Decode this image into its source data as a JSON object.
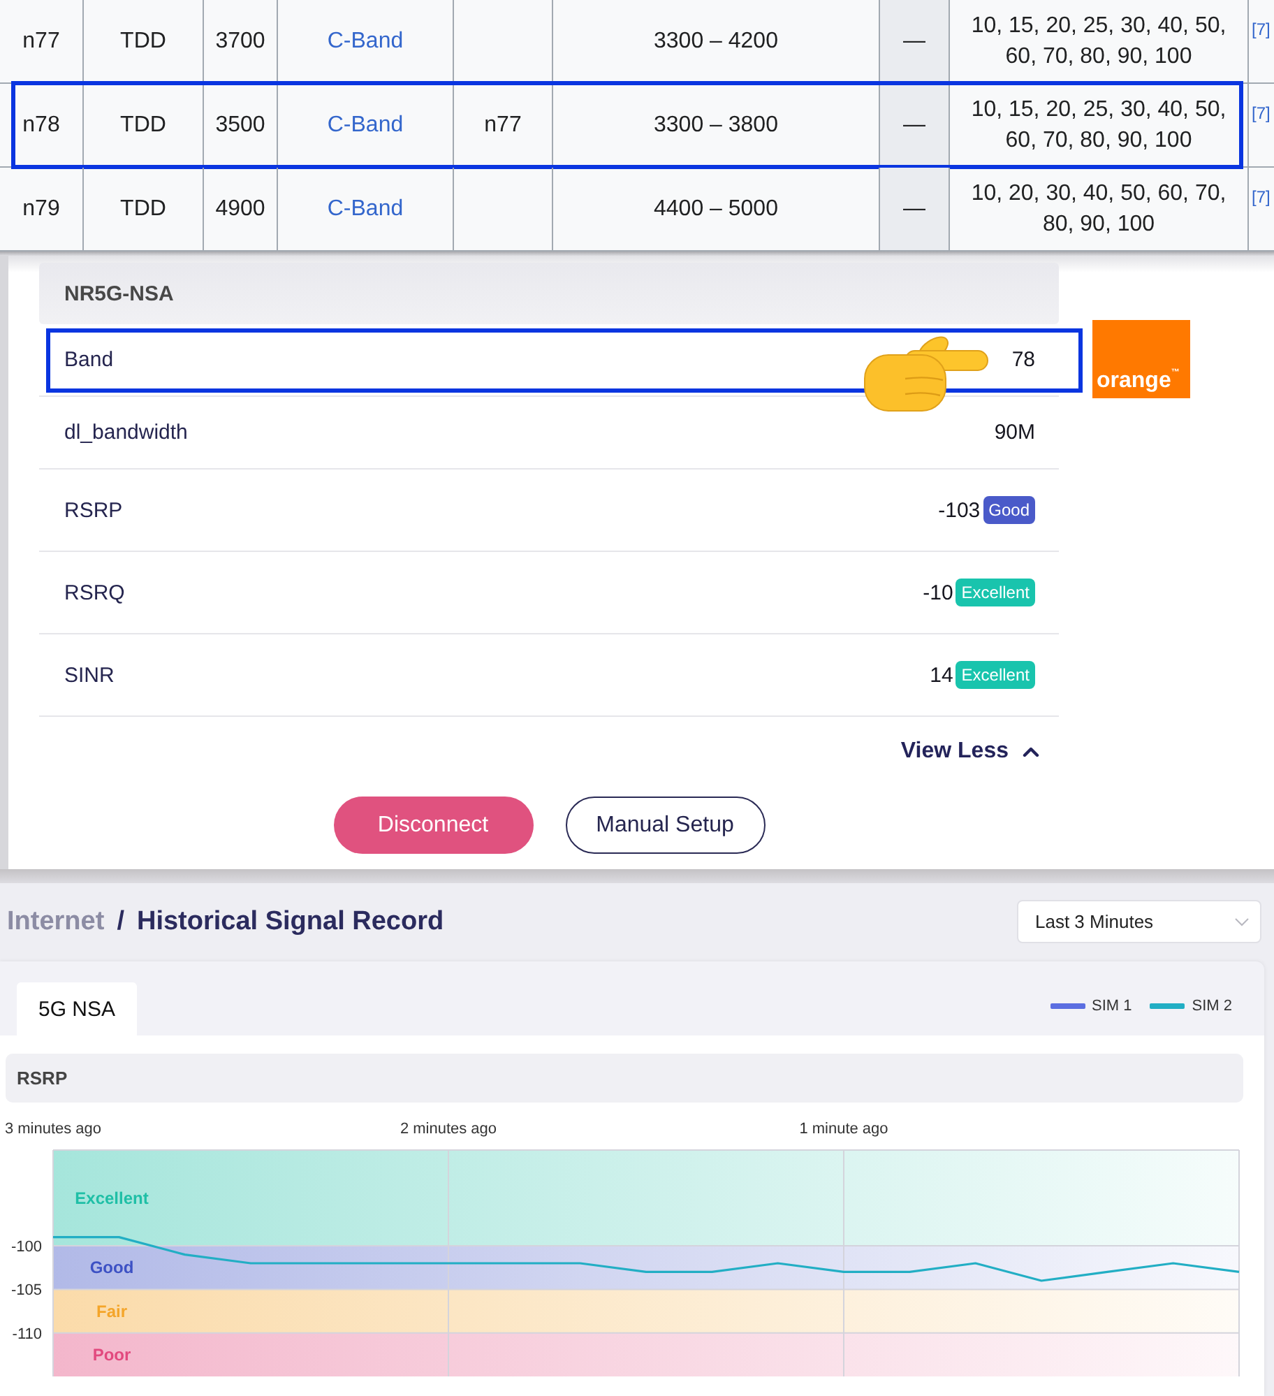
{
  "band_table": {
    "rows": [
      {
        "column_1": "n77",
        "column_2": "TDD",
        "column_3": "3700",
        "column_4": "C-Band",
        "column_6": "3300 – 4200",
        "column_7": "—",
        "column_8": "10, 15, 20, 25, 30, 40, 50, 60, 70, 80, 90, 100",
        "column_9": "[7]",
        "highlighted": false
      },
      {
        "column_1": "n78",
        "column_2": "TDD",
        "column_3": "3500",
        "column_4": "C-Band",
        "column_5": "n77",
        "column_6": "3300 – 3800",
        "column_7": "—",
        "column_8": "10, 15, 20, 25, 30, 40, 50, 60, 70, 80, 90, 100",
        "column_9": "[7]",
        "highlighted": true
      },
      {
        "column_1": "n79",
        "column_2": "TDD",
        "column_3": "4900",
        "column_4": "C-Band",
        "column_6": "4400 – 5000",
        "column_7": "—",
        "column_8": "10, 20, 30, 40, 50, 60, 70, 80, 90, 100",
        "column_9": "[7]",
        "highlighted": false
      }
    ]
  },
  "signal_panel": {
    "title": "NR5G-NSA",
    "rows": [
      {
        "label": "Band",
        "value": "78",
        "highlighted": true
      },
      {
        "label": "dl_bandwidth",
        "value": "90M",
        "highlighted": false
      },
      {
        "label": "RSRP",
        "value": "-103",
        "badge": {
          "text": "Good",
          "color": "#4a5ac9"
        },
        "highlighted": false
      },
      {
        "label": "RSRQ",
        "value": "-10",
        "badge": {
          "text": "Excellent",
          "color": "#19c4ad"
        },
        "highlighted": false
      },
      {
        "label": "SINR",
        "value": "14",
        "badge": {
          "text": "Excellent",
          "color": "#19c4ad"
        },
        "highlighted": false
      }
    ],
    "toggle": {
      "label": "View Less",
      "expanded": true
    },
    "buttons": [
      {
        "label": "Disconnect",
        "kind": "primary"
      },
      {
        "label": "Manual Setup",
        "kind": "outline"
      }
    ]
  },
  "logo": {
    "text": "orange$^{™}$"
  },
  "history": {
    "breadcrumb": [
      {
        "label": "Internet",
        "current": false
      },
      {
        "label": "Historical Signal Record",
        "current": true
      }
    ],
    "separator": "/",
    "range_select": {
      "value": "Last 3 Minutes"
    },
    "tabs": [
      {
        "label": "5G NSA",
        "selected": true
      }
    ],
    "zones": [
      {
        "label": "Excellent",
        "color": "#1fbfa6"
      },
      {
        "label": "Good",
        "color": "#3d51c4"
      },
      {
        "label": "Fair",
        "color": "#f4a52a"
      },
      {
        "label": "Poor",
        "color": "#e2497e"
      }
    ],
    "chart_data": {
      "type": "line",
      "title": "RSRP",
      "categories": [
        "3 minutes ago",
        null,
        null,
        null,
        null,
        null,
        "2 minutes ago",
        null,
        null,
        null,
        null,
        null,
        "1 minute ago",
        null,
        null,
        null,
        null,
        null,
        null
      ],
      "series": [
        {
          "name": "SIM 1",
          "color": "#5b6ee1",
          "values": [
            null,
            null,
            null,
            null,
            null,
            null,
            null,
            null,
            null,
            null,
            null,
            null,
            null,
            null,
            null,
            null,
            null,
            null,
            null
          ]
        },
        {
          "name": "SIM 2",
          "color": "#22aec4",
          "values": [
            -99,
            -99,
            -101,
            -102,
            -102,
            -102,
            -102,
            -102,
            -102,
            -103,
            -103,
            -102,
            -103,
            -103,
            -102,
            -104,
            -103,
            -102,
            -103
          ]
        }
      ],
      "ylim": [
        -115,
        -89
      ],
      "yticks": [
        -100,
        -105,
        -110
      ],
      "grid": true
    }
  }
}
